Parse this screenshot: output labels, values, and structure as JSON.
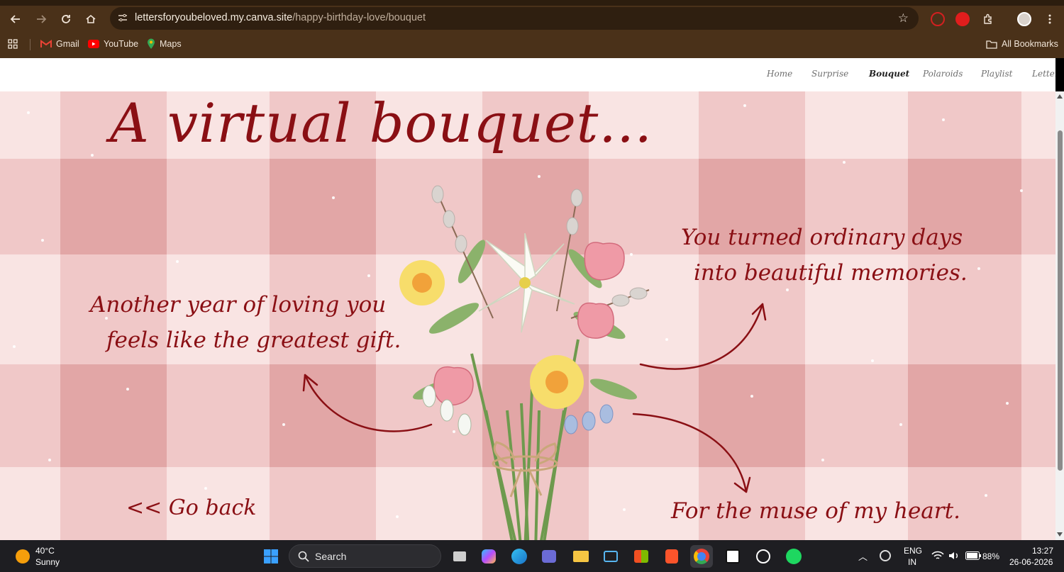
{
  "browser": {
    "url_host": "lettersforyoubeloved.my.canva.site",
    "url_path": "/happy-birthday-love/bouquet",
    "bookmarks": [
      {
        "label": "Gmail"
      },
      {
        "label": "YouTube"
      },
      {
        "label": "Maps"
      }
    ],
    "all_bookmarks": "All Bookmarks"
  },
  "site": {
    "nav": [
      {
        "label": "Home"
      },
      {
        "label": "Surprise"
      },
      {
        "label": "Bouquet",
        "active": true
      },
      {
        "label": "Polaroids"
      },
      {
        "label": "Playlist"
      },
      {
        "label": "Letter"
      }
    ],
    "title": "A virtual bouquet...",
    "note_left_line1": "Another year of loving you",
    "note_left_line2": "feels like the greatest gift.",
    "note_right_line1": "You turned ordinary days",
    "note_right_line2": "into beautiful memories.",
    "note_bottom": "For the muse of my heart.",
    "go_back": "<< Go back"
  },
  "colors": {
    "accent_text": "#8a0f14",
    "gingham_light": "#f9e4e3",
    "gingham_mid": "#efc3c3",
    "gingham_dark": "#e2a6a6",
    "chrome_bg": "#4a3119"
  },
  "taskbar": {
    "weather_temp": "40°C",
    "weather_desc": "Sunny",
    "search_label": "Search",
    "lang_line1": "ENG",
    "lang_line2": "IN",
    "battery": "88%",
    "time": "13:27",
    "date": "26-06-2026"
  }
}
